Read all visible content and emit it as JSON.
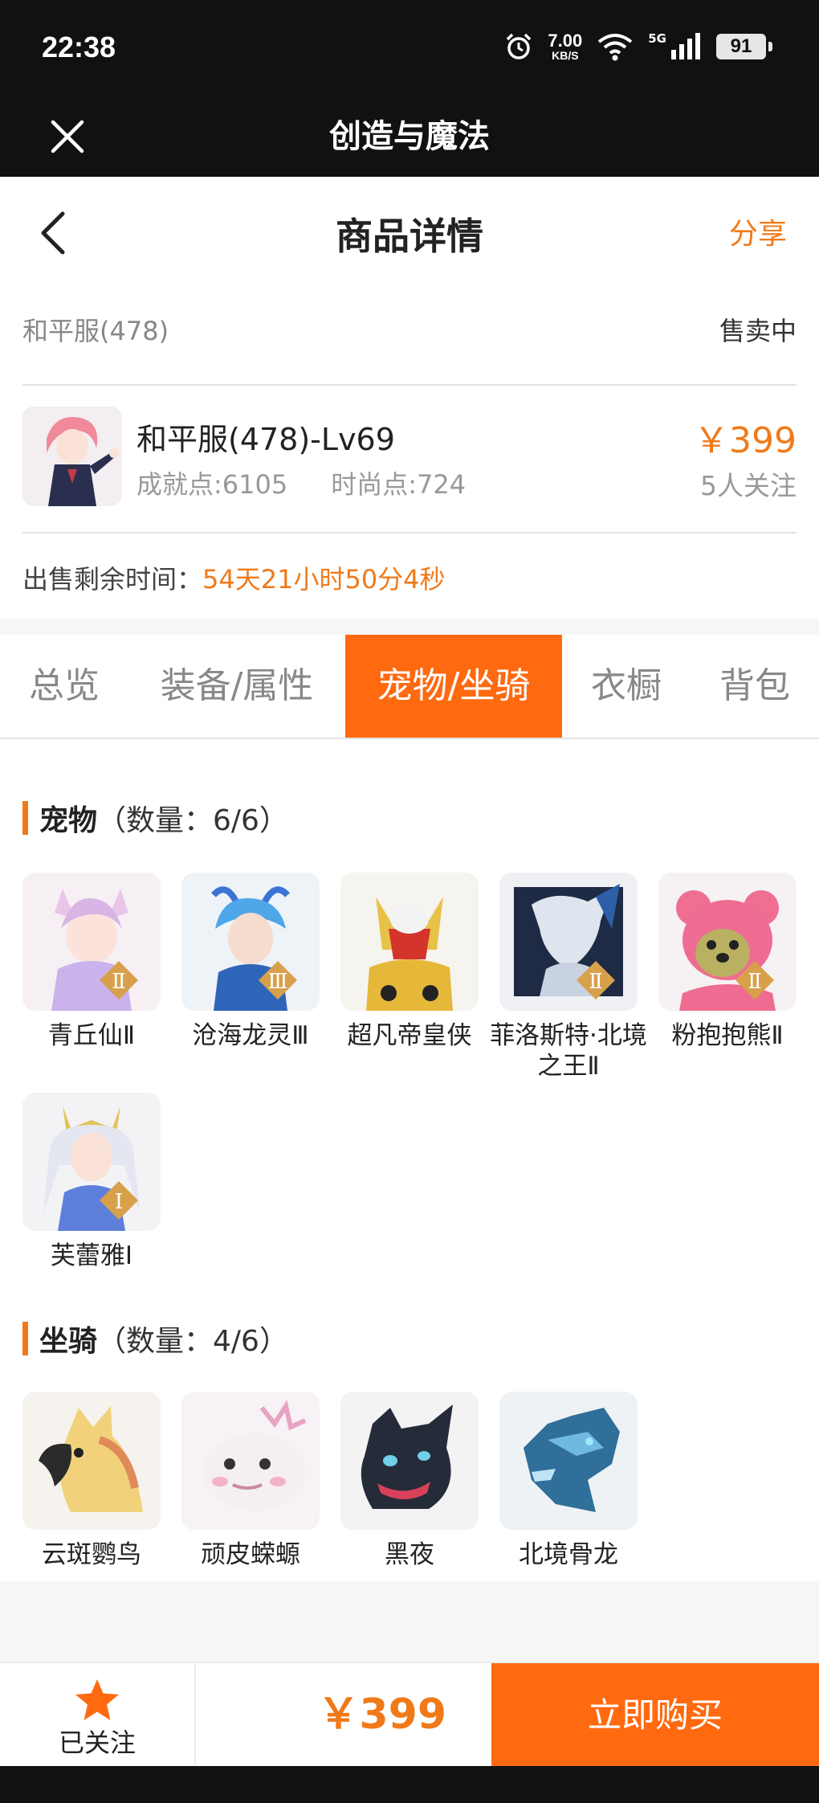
{
  "status_bar": {
    "time": "22:38",
    "net_speed": "7.00",
    "net_unit": "KB/S",
    "signal": "5G",
    "battery": "91"
  },
  "app_bar": {
    "title": "创造与魔法"
  },
  "header": {
    "title": "商品详情",
    "share": "分享"
  },
  "listing": {
    "server": "和平服(478)",
    "status": "售卖中",
    "role_name": "和平服(478)-Lv69",
    "achievement": "成就点:6105",
    "fashion": "时尚点:724",
    "price": "￥399",
    "followers": "5人关注",
    "remaining_label": "出售剩余时间：",
    "remaining_value": "54天21小时50分4秒"
  },
  "tabs": [
    {
      "label": "总览",
      "active": false
    },
    {
      "label": "装备/属性",
      "active": false
    },
    {
      "label": "宠物/坐骑",
      "active": true
    },
    {
      "label": "衣橱",
      "active": false
    },
    {
      "label": "背包",
      "active": false
    }
  ],
  "pets": {
    "title": "宠物",
    "count": "（数量：6/6）",
    "items": [
      {
        "name": "青丘仙Ⅱ",
        "icon": "fox-fairy-pet"
      },
      {
        "name": "沧海龙灵Ⅲ",
        "icon": "sea-dragon-spirit-pet"
      },
      {
        "name": "超凡帝皇侠",
        "icon": "golden-armor-hero-pet"
      },
      {
        "name": "菲洛斯特·北境之王Ⅱ",
        "icon": "north-king-pet"
      },
      {
        "name": "粉抱抱熊Ⅱ",
        "icon": "pink-bear-pet"
      },
      {
        "name": "芙蕾雅Ⅰ",
        "icon": "freya-pet"
      }
    ]
  },
  "mounts": {
    "title": "坐骑",
    "count": "（数量：4/6）",
    "items": [
      {
        "name": "云斑鹦鸟",
        "icon": "parrot-mount"
      },
      {
        "name": "顽皮蝾螈",
        "icon": "axolotl-mount"
      },
      {
        "name": "黑夜",
        "icon": "night-dragon-mount"
      },
      {
        "name": "北境骨龙",
        "icon": "bone-dragon-mount"
      }
    ]
  },
  "bottom_bar": {
    "follow_label": "已关注",
    "total_price": "￥399",
    "buy_label": "立即购买"
  },
  "colors": {
    "accent": "#ff6a10",
    "price": "#f07a1a",
    "dark": "#111111"
  }
}
